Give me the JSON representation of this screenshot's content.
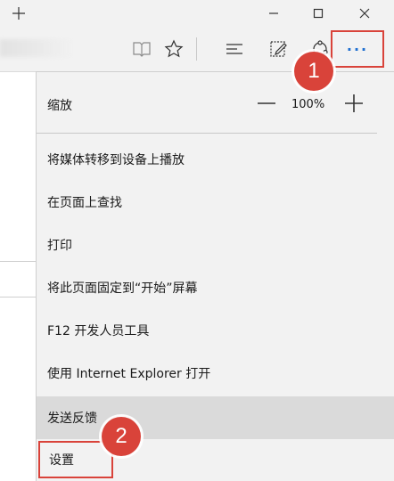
{
  "window": {
    "new_tab_glyph": "+",
    "minimize_glyph": "—",
    "maximize_glyph": "☐",
    "close_glyph": "✕"
  },
  "toolbar": {
    "icons": [
      "reading-view-icon",
      "favorites-star-icon",
      "hub-icon",
      "web-note-icon",
      "share-icon",
      "more-actions-icon"
    ],
    "more_label": "···"
  },
  "menu": {
    "zoom": {
      "label": "缩放",
      "value": "100%"
    },
    "items": [
      {
        "label": "将媒体转移到设备上播放"
      },
      {
        "label": "在页面上查找"
      },
      {
        "label": "打印"
      },
      {
        "label": "将此页面固定到“开始”屏幕"
      },
      {
        "label": "F12 开发人员工具"
      },
      {
        "label": "使用 Internet Explorer 打开"
      },
      {
        "label": "发送反馈"
      },
      {
        "label": "设置"
      }
    ]
  },
  "callouts": {
    "step1": "1",
    "step2": "2"
  },
  "colors": {
    "highlight_red": "#d9433a",
    "accent_blue": "#1f6fd0",
    "hover_gray": "#dadada"
  }
}
